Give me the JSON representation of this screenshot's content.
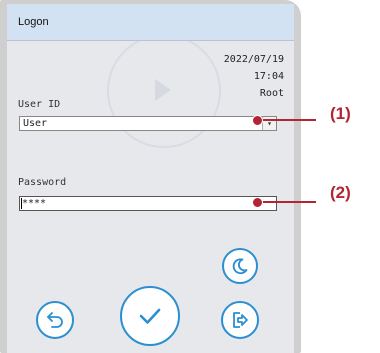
{
  "window": {
    "title": "Logon"
  },
  "status": {
    "date": "2022/07/19",
    "time": "17:04",
    "user": "Root"
  },
  "user_id": {
    "label": "User ID",
    "value": "User"
  },
  "password": {
    "label": "Password",
    "value": "****"
  },
  "callouts": [
    "(1)",
    "(2)"
  ],
  "icons": {
    "moon": "moon-icon",
    "back": "undo-arrow-icon",
    "ok": "checkmark-icon",
    "logout": "logout-icon"
  },
  "colors": {
    "accent": "#2c8fd0",
    "callout": "#b32434",
    "title_bar": "#d3e2f2"
  }
}
